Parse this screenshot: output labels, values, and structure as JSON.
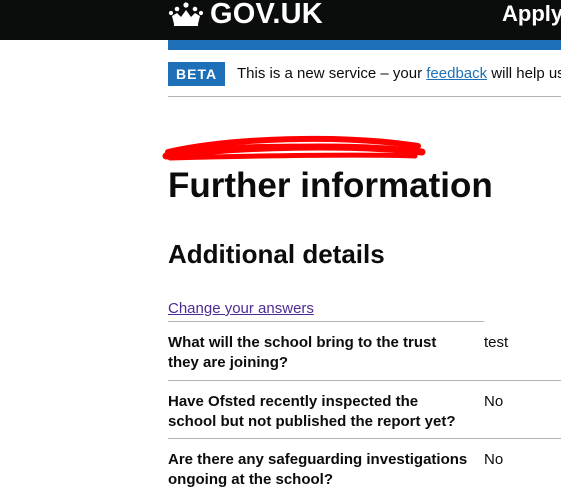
{
  "header": {
    "logo_text": "GOV.UK",
    "service_name": "Apply"
  },
  "phase_banner": {
    "tag": "BETA",
    "text_before": "This is a new service – your ",
    "link": "feedback",
    "text_after": " will help us"
  },
  "page": {
    "title": "Further information",
    "section_title": "Additional details",
    "change_link": "Change your answers"
  },
  "summary": [
    {
      "key": "What will the school bring to the trust they are joining?",
      "value": "test"
    },
    {
      "key": "Have Ofsted recently inspected the school but not published the report yet?",
      "value": "No"
    },
    {
      "key": "Are there any safeguarding investigations ongoing at the school?",
      "value": "No"
    }
  ],
  "colors": {
    "header_bg": "#0b0c0c",
    "brand_blue": "#1d70b8",
    "visited_link": "#4c2c92",
    "border": "#b1b4b6",
    "redaction": "#ff0000"
  }
}
